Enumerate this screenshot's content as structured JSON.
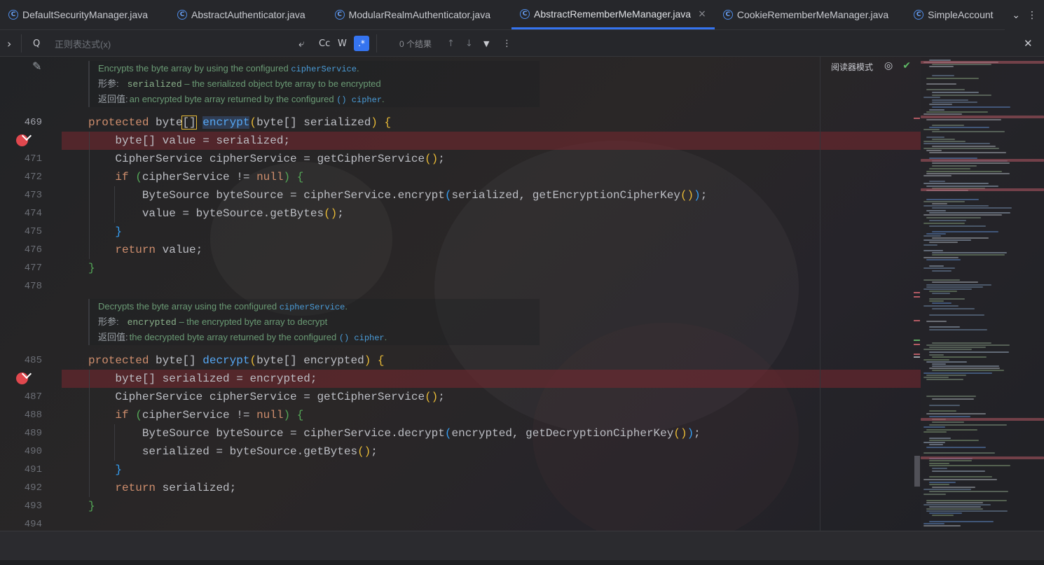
{
  "tabs": [
    {
      "label": "DefaultSecurityManager.java",
      "active": false
    },
    {
      "label": "AbstractAuthenticator.java",
      "active": false
    },
    {
      "label": "ModularRealmAuthenticator.java",
      "active": false
    },
    {
      "label": "AbstractRememberMeManager.java",
      "active": true
    },
    {
      "label": "CookieRememberMeManager.java",
      "active": false
    },
    {
      "label": "SimpleAccount",
      "active": false
    }
  ],
  "tab_icon_glyph": "C",
  "tab_close_glyph": "×",
  "tab_controls": {
    "more": "⌄",
    "menu": "⋮"
  },
  "search": {
    "expand": "›",
    "search_icon": "Q",
    "placeholder": "正则表达式(x)",
    "opt_newline": "⤶",
    "opt_case": "Cc",
    "opt_word": "W",
    "opt_regex": ".*",
    "results": "0 个结果",
    "prev": "↑",
    "next": "↓",
    "filter": "▼",
    "more": "⋮",
    "close": "✕"
  },
  "reader": {
    "label": "阅读器模式",
    "hide_icon": "◎",
    "check_icon": "✔"
  },
  "pencil_icon": "✎",
  "docs": [
    {
      "summary_prefix": "Encrypts the byte array by using the configured ",
      "summary_code": "cipherService",
      "summary_suffix": ".",
      "param_label": "形参:",
      "param_name": "serialized",
      "param_desc": " – the serialized object byte array to be encrypted",
      "return_label": "返回值:",
      "return_prefix": "an encrypted byte array returned by the configured ",
      "return_code": "() cipher",
      "return_suffix": "."
    },
    {
      "summary_prefix": "Decrypts the byte array using the configured ",
      "summary_code": "cipherService",
      "summary_suffix": ".",
      "param_label": "形参:",
      "param_name": "encrypted",
      "param_desc": " – the encrypted byte array to decrypt",
      "return_label": "返回值:",
      "return_prefix": "the decrypted byte array returned by the configured ",
      "return_code": "() cipher",
      "return_suffix": "."
    }
  ],
  "line_numbers": [
    "469",
    "",
    "471",
    "472",
    "473",
    "474",
    "475",
    "476",
    "477",
    "478",
    "485",
    "",
    "487",
    "488",
    "489",
    "490",
    "491",
    "492",
    "493",
    "494"
  ],
  "code": {
    "l469": {
      "kw": "protected ",
      "t1": "byte",
      "b1": "[]",
      "sp": " ",
      "fn": "encrypt",
      "p1": "(",
      "t2": "byte[] serialized",
      "p2": ")",
      "rest": " ",
      "ob": "{"
    },
    "l470": {
      "text": "    byte[] value = serialized;"
    },
    "l471": {
      "text": "    CipherService cipherService = getCipherService",
      "p": "()",
      "end": ";"
    },
    "l472": {
      "kw": "    if ",
      "p1": "(",
      "t": "cipherService != ",
      "kw2": "null",
      "p2": ")",
      "sp": " ",
      "ob": "{"
    },
    "l473": {
      "a": "        ByteSource byteSource = cipherService.encrypt",
      "p1": "(",
      "b": "serialized, getEncryptionCipherKey",
      "p2": "()",
      "p3": ")",
      "end": ";"
    },
    "l474": {
      "a": "        value = byteSource.getBytes",
      "p": "()",
      "end": ";"
    },
    "l475": {
      "cb": "    }"
    },
    "l476": {
      "kw": "    return ",
      "t": "value;"
    },
    "l477": {
      "cb": "}"
    },
    "l485": {
      "kw": "protected ",
      "t1": "byte[] ",
      "fn": "decrypt",
      "p1": "(",
      "t2": "byte[] encrypted",
      "p2": ")",
      "rest": " ",
      "ob": "{"
    },
    "l486": {
      "text": "    byte[] serialized = encrypted;"
    },
    "l487": {
      "text": "    CipherService cipherService = getCipherService",
      "p": "()",
      "end": ";"
    },
    "l488": {
      "kw": "    if ",
      "p1": "(",
      "t": "cipherService != ",
      "kw2": "null",
      "p2": ")",
      "sp": " ",
      "ob": "{"
    },
    "l489": {
      "a": "        ByteSource byteSource = cipherService.decrypt",
      "p1": "(",
      "b": "encrypted, getDecryptionCipherKey",
      "p2": "()",
      "p3": ")",
      "end": ";"
    },
    "l490": {
      "a": "        serialized = byteSource.getBytes",
      "p": "()",
      "end": ";"
    },
    "l491": {
      "cb": "    }"
    },
    "l492": {
      "kw": "    return ",
      "t": "serialized;"
    },
    "l493": {
      "cb": "}"
    }
  }
}
